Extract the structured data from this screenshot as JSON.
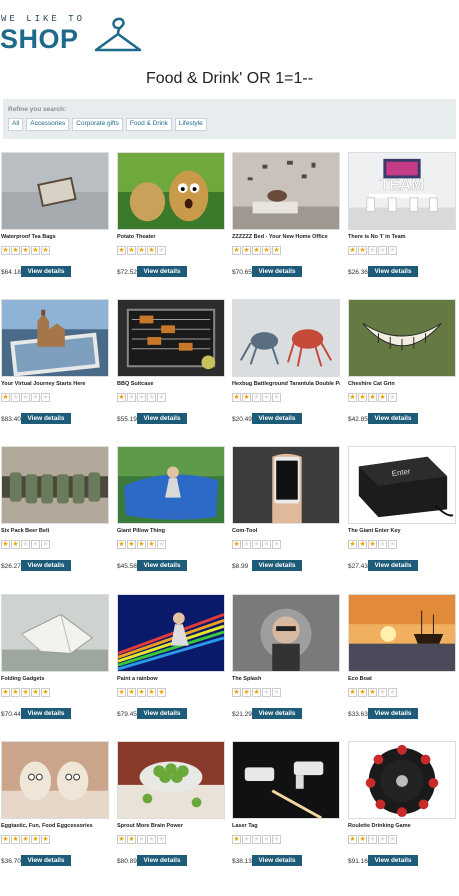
{
  "logo": {
    "tagline": "WE LIKE TO",
    "name": "SHOP"
  },
  "page_title": "Food & Drink' OR 1=1--",
  "refine": {
    "label": "Refine you search:",
    "categories": [
      "All",
      "Accessories",
      "Corporate gifts",
      "Food & Drink",
      "Lifestyle"
    ]
  },
  "button_label": "View details",
  "colors": {
    "brand": "#1d6a8a",
    "button": "#1d5b79",
    "star": "#f0a500",
    "refine_bg": "#e7ecef"
  },
  "products": [
    {
      "name": "Waterproof Tea Bags",
      "price": "$64.18",
      "rating": 5,
      "icon": "tea-bag-image"
    },
    {
      "name": "Potato Theater",
      "price": "$72.52",
      "rating": 4,
      "icon": "potato-image"
    },
    {
      "name": "ZZZZZZ Bed - Your New Home Office",
      "price": "$70.65",
      "rating": 5,
      "icon": "bed-image"
    },
    {
      "name": "There is No 'I' in Team",
      "price": "$26.36",
      "rating": 2,
      "icon": "team-image"
    },
    {
      "name": "Your Virtual Journey Starts Here",
      "price": "$83.40",
      "rating": 1,
      "icon": "castle-tablet-image"
    },
    {
      "name": "BBQ Suitcase",
      "price": "$55.19",
      "rating": 1,
      "icon": "bbq-image"
    },
    {
      "name": "Hexbug Battleground Tarantula Double Pack",
      "price": "$20.49",
      "rating": 2,
      "icon": "robot-spider-image"
    },
    {
      "name": "Cheshire Cat Grin",
      "price": "$42.85",
      "rating": 4,
      "icon": "grin-image"
    },
    {
      "name": "Six Pack Beer Belt",
      "price": "$26.27",
      "rating": 2,
      "icon": "beer-belt-image"
    },
    {
      "name": "Giant Pillow Thing",
      "price": "$45.58",
      "rating": 4,
      "icon": "pillow-image"
    },
    {
      "name": "Com-Tool",
      "price": "$8.99",
      "rating": 1,
      "icon": "phone-image"
    },
    {
      "name": "The Giant Enter Key",
      "price": "$27.43",
      "rating": 3,
      "icon": "enter-key-image"
    },
    {
      "name": "Folding Gadgets",
      "price": "$70.44",
      "rating": 5,
      "icon": "origami-image"
    },
    {
      "name": "Paint a rainbow",
      "price": "$79.45",
      "rating": 5,
      "icon": "rainbow-image"
    },
    {
      "name": "The Splash",
      "price": "$21.29",
      "rating": 3,
      "icon": "splash-image"
    },
    {
      "name": "Eco Boat",
      "price": "$33.63",
      "rating": 3,
      "icon": "boat-image"
    },
    {
      "name": "Eggtastic, Fun, Food Eggcessories",
      "price": "$36.70",
      "rating": 5,
      "icon": "eggs-image"
    },
    {
      "name": "Sprout More Brain Power",
      "price": "$80.89",
      "rating": 2,
      "icon": "sprouts-image"
    },
    {
      "name": "Laser Tag",
      "price": "$38.13",
      "rating": 1,
      "icon": "laser-tag-image"
    },
    {
      "name": "Roulette Drinking Game",
      "price": "$91.16",
      "rating": 2,
      "icon": "roulette-image"
    }
  ]
}
